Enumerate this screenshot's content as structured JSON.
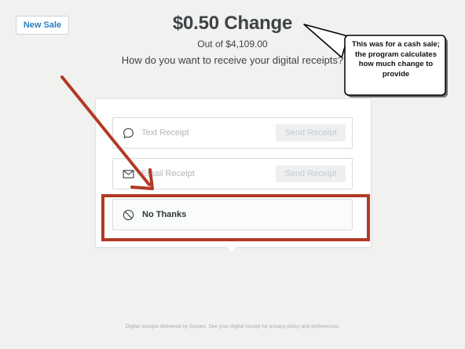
{
  "toolbar": {
    "new_sale_label": "New Sale"
  },
  "header": {
    "change": "$0.50 Change",
    "total": "Out of $4,109.00",
    "prompt": "How do you want to receive your digital receipts?"
  },
  "receipt_options": {
    "text": {
      "placeholder": "Text Receipt",
      "send_label": "Send Receipt",
      "icon": "speech-bubble-icon"
    },
    "email": {
      "placeholder": "Email Receipt",
      "send_label": "Send Receipt",
      "icon": "envelope-icon"
    },
    "none": {
      "label": "No Thanks",
      "icon": "prohibited-icon"
    }
  },
  "annotation": {
    "callout": "This was for a cash sale; the program calculates how much change to provide",
    "highlight_color": "#b23a26"
  },
  "footer": {
    "text": "Digital receipts delivered by Square. See your digital receipt for privacy policy and preferences."
  },
  "colors": {
    "accent": "#2a7fc2",
    "background": "#f1f1f0",
    "text": "#3d4346"
  }
}
